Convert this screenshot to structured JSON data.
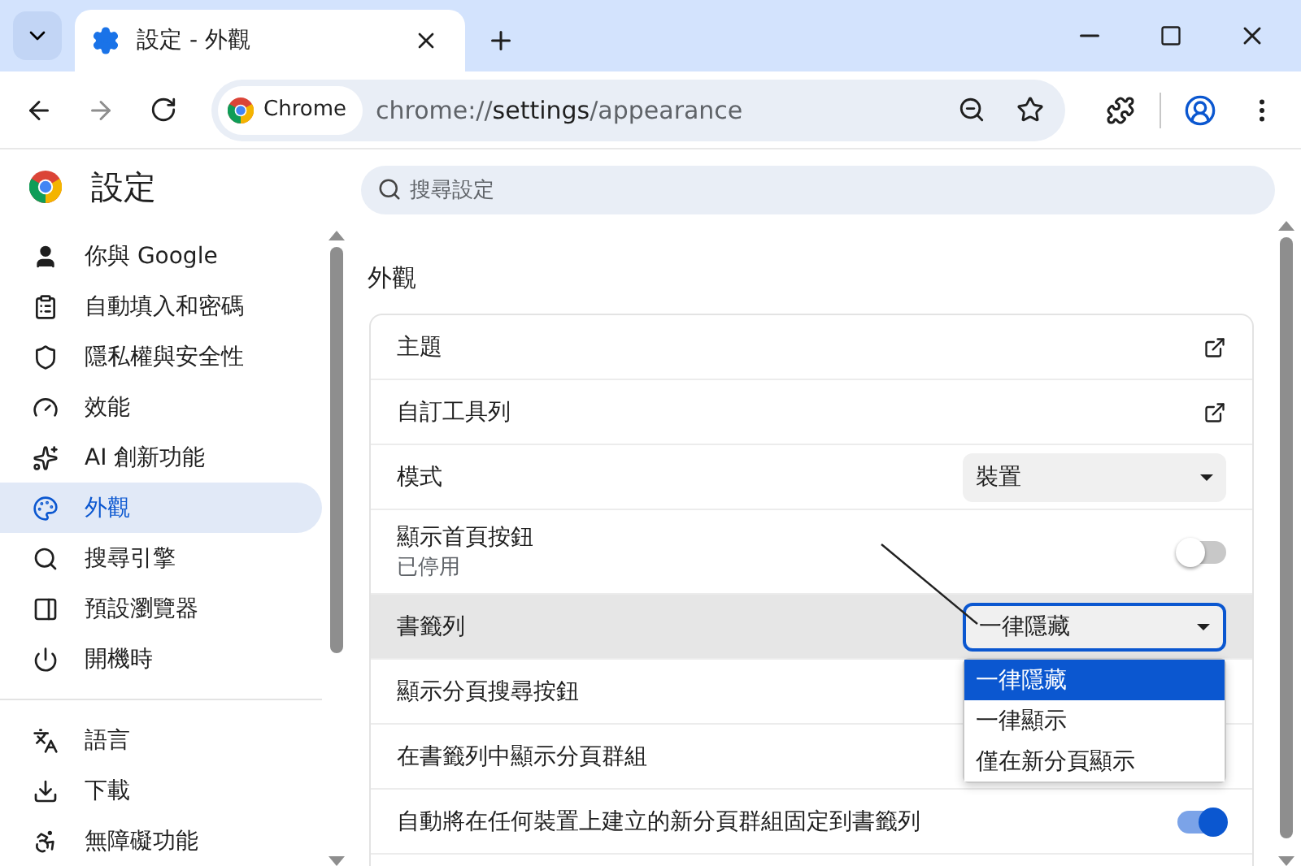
{
  "window": {
    "tab_title": "設定 - 外觀"
  },
  "address_bar": {
    "chip": "Chrome",
    "url_scheme": "chrome://",
    "url_host": "settings",
    "url_path": "/appearance"
  },
  "sidebar": {
    "title": "設定",
    "groups": [
      [
        {
          "label": "你與 Google",
          "selected": false
        },
        {
          "label": "自動填入和密碼",
          "selected": false
        },
        {
          "label": "隱私權與安全性",
          "selected": false
        },
        {
          "label": "效能",
          "selected": false
        },
        {
          "label": "AI 創新功能",
          "selected": false
        },
        {
          "label": "外觀",
          "selected": true
        },
        {
          "label": "搜尋引擎",
          "selected": false
        },
        {
          "label": "預設瀏覽器",
          "selected": false
        },
        {
          "label": "開機時",
          "selected": false
        }
      ],
      [
        {
          "label": "語言",
          "selected": false
        },
        {
          "label": "下載",
          "selected": false
        },
        {
          "label": "無障礙功能",
          "selected": false
        }
      ]
    ]
  },
  "search": {
    "placeholder": "搜尋設定"
  },
  "section": {
    "title": "外觀",
    "rows": [
      {
        "kind": "link",
        "label": "主題",
        "highlighted": false
      },
      {
        "kind": "link",
        "label": "自訂工具列",
        "highlighted": false
      },
      {
        "kind": "select",
        "label": "模式",
        "value": "裝置",
        "focused": false,
        "highlighted": false
      },
      {
        "kind": "toggle",
        "label": "顯示首頁按鈕",
        "sublabel": "已停用",
        "on": false,
        "highlighted": false
      },
      {
        "kind": "select",
        "label": "書籤列",
        "value": "一律隱藏",
        "focused": true,
        "highlighted": true,
        "options": [
          {
            "label": "一律隱藏",
            "selected": true
          },
          {
            "label": "一律顯示",
            "selected": false
          },
          {
            "label": "僅在新分頁顯示",
            "selected": false
          }
        ]
      },
      {
        "kind": "plain",
        "label": "顯示分頁搜尋按鈕",
        "highlighted": false
      },
      {
        "kind": "plain",
        "label": "在書籤列中顯示分頁群組",
        "highlighted": false
      },
      {
        "kind": "toggle",
        "label": "自動將在任何裝置上建立的新分頁群組固定到書籤列",
        "on": true,
        "highlighted": false
      }
    ]
  }
}
